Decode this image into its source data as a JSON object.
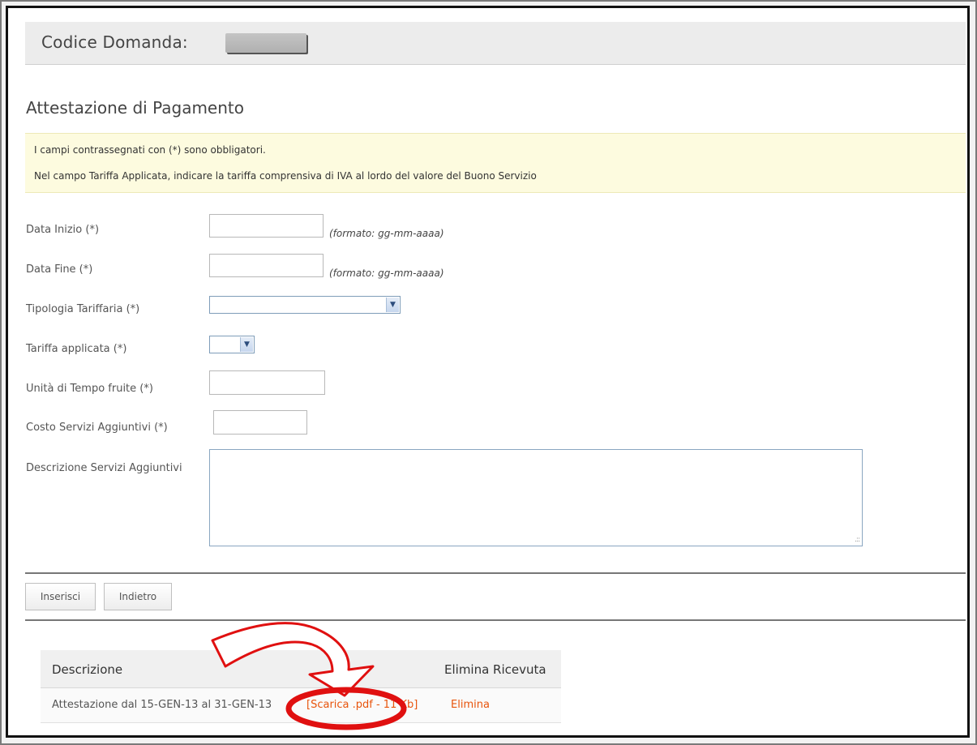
{
  "header": {
    "title": "Codice Domanda:"
  },
  "section_title": "Attestazione di Pagamento",
  "notice": {
    "line1": "I campi contrassegnati con (*) sono obbligatori.",
    "line2": "Nel campo Tariffa Applicata, indicare la tariffa comprensiva di IVA al lordo del valore del Buono Servizio"
  },
  "form": {
    "data_inizio": {
      "label": "Data Inizio (*)",
      "value": "",
      "hint": "(formato: gg-mm-aaaa)"
    },
    "data_fine": {
      "label": "Data Fine (*)",
      "value": "",
      "hint": "(formato: gg-mm-aaaa)"
    },
    "tipologia": {
      "label": "Tipologia Tariffaria (*)",
      "selected": ""
    },
    "tariffa": {
      "label": "Tariffa applicata (*)",
      "selected": ""
    },
    "unita": {
      "label": "Unità di Tempo fruite (*)",
      "value": ""
    },
    "costo": {
      "label": "Costo Servizi Aggiuntivi (*)",
      "value": ""
    },
    "descrizione": {
      "label": "Descrizione Servizi Aggiuntivi",
      "value": ""
    }
  },
  "buttons": {
    "inserisci": "Inserisci",
    "indietro": "Indietro"
  },
  "table": {
    "headers": {
      "descrizione": "Descrizione",
      "elimina": "Elimina Ricevuta"
    },
    "rows": [
      {
        "descrizione": "Attestazione dal 15-GEN-13 al 31-GEN-13",
        "download": "[Scarica .pdf - 11 Kb]",
        "elimina": "Elimina"
      }
    ]
  },
  "colors": {
    "link": "#e8540c",
    "annotation": "#e01010",
    "notice_bg": "#fdfbdf"
  },
  "icons": {
    "annotation_arrow": "curved-arrow-icon",
    "annotation_circle": "highlight-ellipse"
  }
}
